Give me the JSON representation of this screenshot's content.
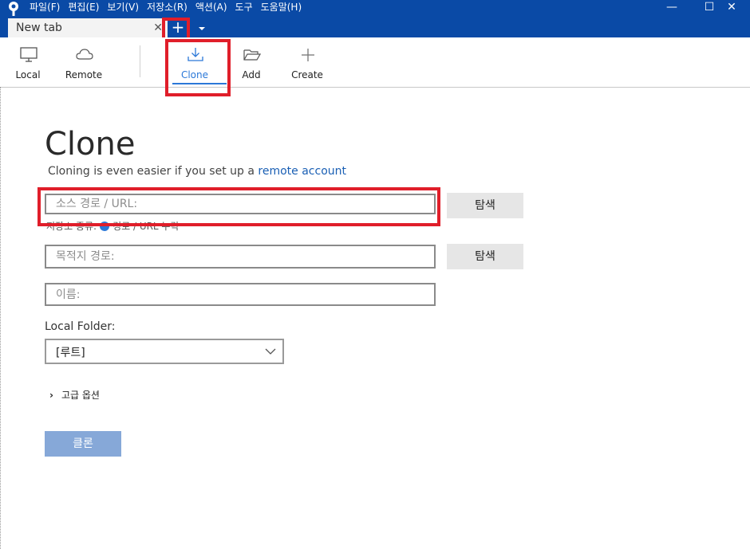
{
  "menu": [
    "파일(F)",
    "편집(E)",
    "보기(V)",
    "저장소(R)",
    "액션(A)",
    "도구",
    "도움말(H)"
  ],
  "window_controls": {
    "minimize": "—",
    "maximize": "☐",
    "close": "✕"
  },
  "tab": {
    "label": "New tab",
    "close": "✕",
    "new": "+"
  },
  "toolbar": {
    "local": "Local",
    "remote": "Remote",
    "clone": "Clone",
    "add": "Add",
    "create": "Create"
  },
  "clone_page": {
    "title": "Clone",
    "subtitle_prefix": "Cloning is even easier if you set up a ",
    "subtitle_link": "remote account",
    "source_placeholder": "소스 경로 / URL:",
    "browse_label": "탐색",
    "repo_type_label": "저장소 종류:",
    "repo_type_value": "경로 / URL 누락",
    "dest_placeholder": "목적지 경로:",
    "name_placeholder": "이름:",
    "local_folder_label": "Local Folder:",
    "local_folder_value": "[루트]",
    "advanced_label": "고급 옵션",
    "clone_button": "클론"
  },
  "colors": {
    "titlebar": "#0a4aa6",
    "accent": "#2b78d8",
    "highlight": "#e01e2a"
  }
}
